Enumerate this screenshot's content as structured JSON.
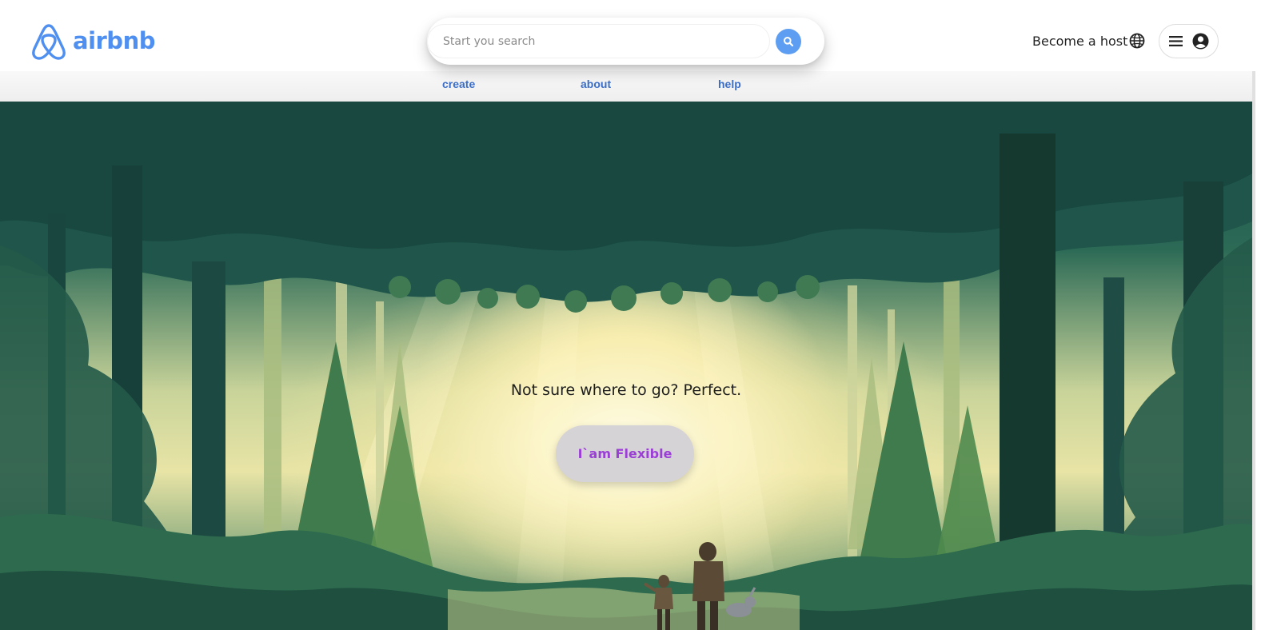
{
  "brand": {
    "name": "airbnb",
    "color": "#4f8ff0"
  },
  "search": {
    "placeholder": "Start you search",
    "button_icon": "search-icon",
    "button_color": "#5e9ef2"
  },
  "header": {
    "host_link": "Become a host",
    "globe_icon": "globe-icon",
    "menu_icon": "hamburger-icon",
    "user_icon": "user-circle-icon"
  },
  "subnav": {
    "items": [
      {
        "label": "create"
      },
      {
        "label": "about"
      },
      {
        "label": "help"
      }
    ],
    "color": "#3c6fc9"
  },
  "hero": {
    "tagline": "Not sure where to go? Perfect.",
    "cta_label": "I`am Flexible",
    "cta_color": "#9c3fd6"
  }
}
